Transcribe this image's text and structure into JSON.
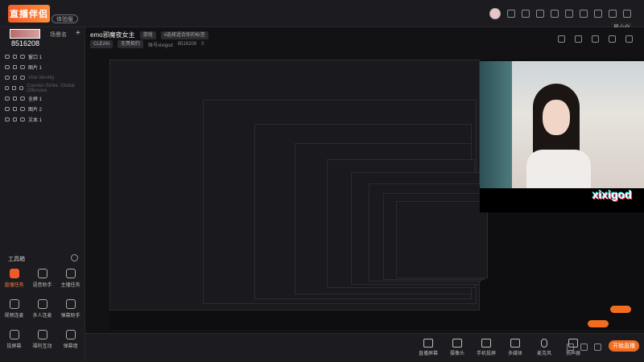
{
  "app": {
    "logo_text": "直播伴侣",
    "beta": "体验版",
    "tooltip": "最小化"
  },
  "scene": {
    "thumb_text": "",
    "name": "场景名",
    "plus": "+",
    "id": "8516208"
  },
  "layers": [
    {
      "label": "窗口 1",
      "dim": false
    },
    {
      "label": "图片 1",
      "dim": false
    },
    {
      "label": "Vital Identity",
      "dim": true
    },
    {
      "label": "Counter-Strike: Global Offensive",
      "dim": true
    },
    {
      "label": "全屏 1",
      "dim": false
    },
    {
      "label": "图片 2",
      "dim": false
    },
    {
      "label": "文本 1",
      "dim": false
    }
  ],
  "tools_panel": {
    "title": "工具箱",
    "items": [
      {
        "label": "直播任务",
        "active": true
      },
      {
        "label": "语音助手",
        "active": false
      },
      {
        "label": "主播任务",
        "active": false
      },
      {
        "label": "视频连麦",
        "active": false
      },
      {
        "label": "多人连麦",
        "active": false
      },
      {
        "label": "弹幕助手",
        "active": false
      },
      {
        "label": "投屏幕",
        "active": false
      },
      {
        "label": "福利互动",
        "active": false
      },
      {
        "label": "弹幕墙",
        "active": false
      }
    ]
  },
  "stream_info": {
    "title": "emo邪魔夜女主",
    "category_chip": "游戏",
    "tag_chip": "#选择适合你的标签",
    "clean_chip": "CLEAN",
    "game_chip": "无畏契约",
    "account": "账号xixigod",
    "account_id": "8516208",
    "likes": "0"
  },
  "preview": {
    "overlay_text": "xixigod"
  },
  "bottom_bar": {
    "buttons": [
      "直播屏幕",
      "摄像头",
      "手机投屏",
      "多媒体",
      "麦克风",
      "扬声器"
    ],
    "start_label": "开始直播"
  },
  "colors": {
    "accent": "#f26c1f",
    "bg": "#16161a",
    "panel": "#1c1c20"
  }
}
